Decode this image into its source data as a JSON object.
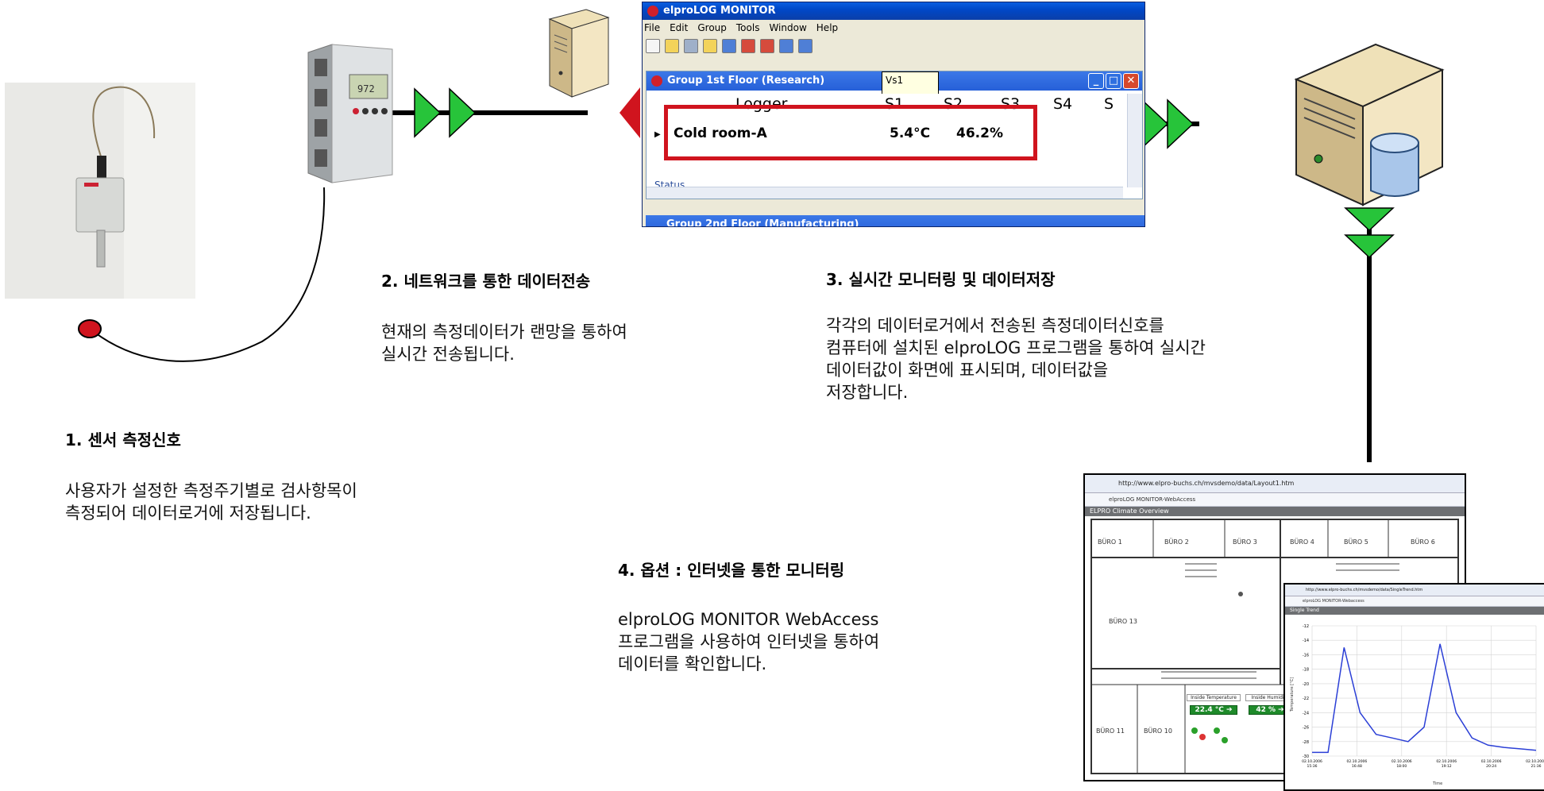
{
  "app_window": {
    "title": "elproLOG MONITOR",
    "menu": [
      "File",
      "Edit",
      "Group",
      "Tools",
      "Window",
      "Help"
    ],
    "group1_title": "Group 1st Floor (Research)",
    "tooltip": "Vs1",
    "columns": [
      "Logger",
      "S1",
      "S2",
      "S3",
      "S4",
      "S"
    ],
    "row": {
      "logger": "Cold room-A",
      "s1": "5.4°C",
      "s2": "46.2%"
    },
    "status_label": "Status",
    "group2_title": "Group 2nd Floor (Manufacturing)"
  },
  "steps": [
    {
      "title": "1. 센서 측정신호",
      "text": "사용자가 설정한 측정주기별로 검사항목이\n측정되어 데이터로거에 저장됩니다."
    },
    {
      "title": "2. 네트워크를 통한 데이터전송",
      "text": "현재의 측정데이터가 랜망을 통하여\n실시간 전송됩니다."
    },
    {
      "title": "3. 실시간 모니터링 및 데이터저장",
      "text": "각각의 데이터로거에서 전송된 측정데이터신호를\n컴퓨터에 설치된 elproLOG 프로그램을 통하여 실시간\n데이터값이 화면에 표시되며, 데이터값을\n저장합니다."
    },
    {
      "title": "4. 옵션 : 인터넷을 통한 모니터링",
      "text": "elproLOG MONITOR WebAccess\n프로그램을 사용하여 인터넷을 통하여\n데이터를 확인합니다."
    }
  ],
  "web_overview": {
    "address": "http://www.elpro-buchs.ch/mvsdemo/data/Layout1.htm",
    "tab": "elproLOG MONITOR-WebAccess",
    "header": "ELPRO Climate Overview",
    "rooms": [
      "BÜRO 1",
      "BÜRO 2",
      "BÜRO 3",
      "BÜRO 4",
      "BÜRO 5",
      "BÜRO 6",
      "BÜRO 13",
      "BÜRO 11",
      "BÜRO 10"
    ],
    "temp_label": "Inside Temperature",
    "temp_value": "22.4 °C ➔",
    "hum_label": "Inside Humidity",
    "hum_value": "42 % ➔"
  },
  "web_trend": {
    "address": "http://www.elpro-buchs.ch/mvsdemo/data/SingleTrend.htm",
    "tab": "elproLOG MONITOR-Webaccess",
    "header": "Single Trend",
    "y_label": "Temperature [°C]",
    "x_label": "Time",
    "y_ticks": [
      "-12",
      "-14",
      "-16",
      "-18",
      "-20",
      "-22",
      "-24",
      "-26",
      "-28",
      "-30"
    ],
    "x_ticks": [
      "02.10.2006\n15:36",
      "02.10.2006\n16:48",
      "02.10.2006\n18:00",
      "02.10.2006\n19:12",
      "02.10.2006\n20:24",
      "02.10.2006\n21:36"
    ]
  },
  "chart_data": {
    "type": "line",
    "x": [
      "15:36",
      "15:50",
      "16:05",
      "16:30",
      "16:55",
      "17:10",
      "17:25",
      "17:40",
      "18:00",
      "18:30",
      "19:12",
      "20:00",
      "20:24",
      "21:00",
      "21:36"
    ],
    "series": [
      {
        "values": [
          -29.5,
          -29.5,
          -15,
          -24,
          -27,
          -27.5,
          -28,
          -26,
          -14.5,
          -24,
          -27.5,
          -28.5,
          -28.8,
          -29,
          -29.2
        ]
      }
    ],
    "ylim": [
      -30,
      -12
    ],
    "line_color": "#2b3fd6"
  }
}
